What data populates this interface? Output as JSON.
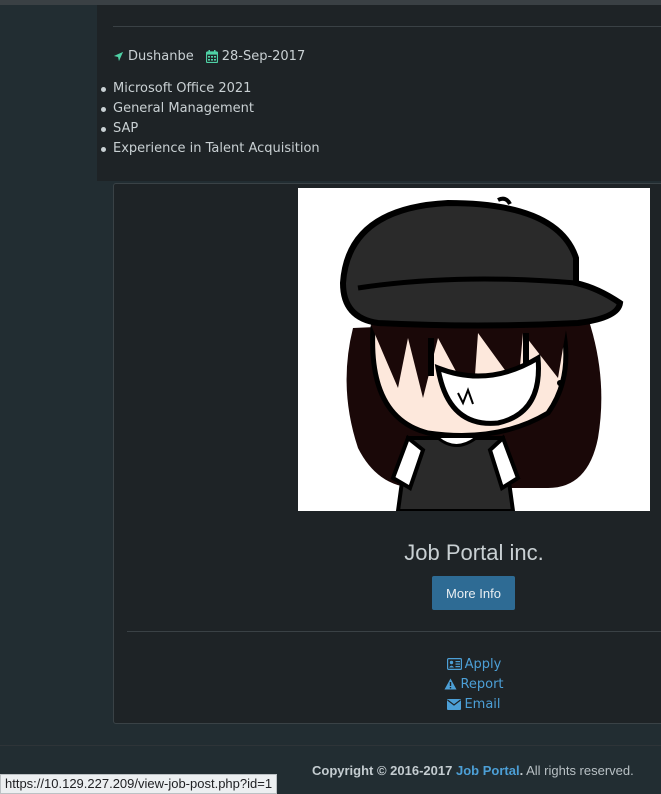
{
  "job": {
    "location": "Dushanbe",
    "date": "28-Sep-2017",
    "skills": [
      "Microsoft Office 2021",
      "General Management",
      "SAP",
      "Experience in Talent Acquisition"
    ]
  },
  "company": {
    "name": "Job Portal inc.",
    "more_info_label": "More Info",
    "actions": {
      "apply": "Apply",
      "report": "Report",
      "email": "Email"
    }
  },
  "footer": {
    "copyright_prefix": "Copyright © 2016-2017",
    "brand": "Job Portal",
    "suffix": "All rights reserved."
  },
  "status_bar": {
    "url": "https://10.129.227.209/view-job-post.php?id=1"
  },
  "colors": {
    "accent_icon": "#4fd1a5",
    "link": "#4c9fd6",
    "button": "#2e6b94"
  }
}
